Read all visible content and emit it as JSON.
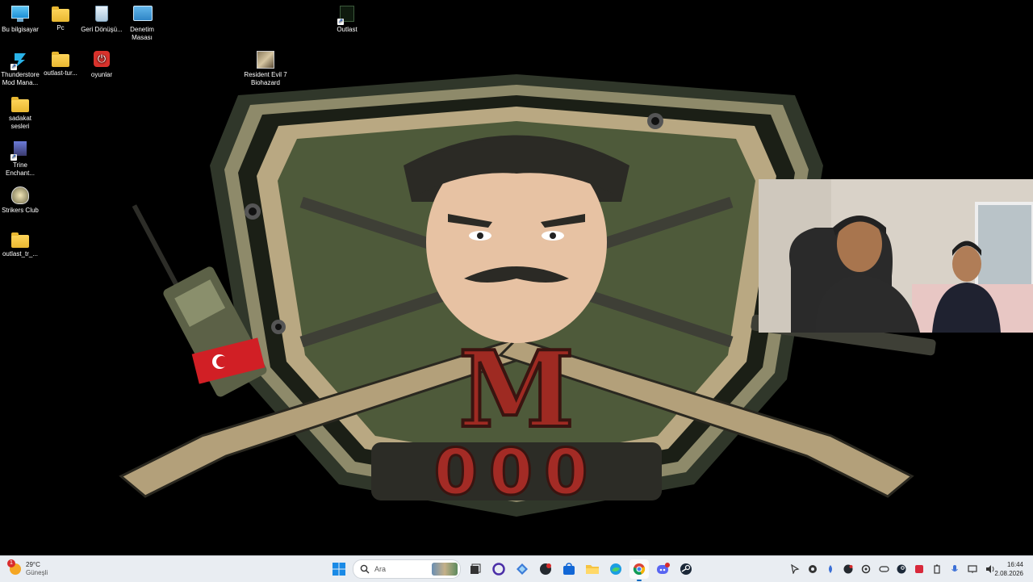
{
  "desktop": {
    "icons": [
      {
        "label": "Bu bilgisayar"
      },
      {
        "label": "Pc"
      },
      {
        "label": "Geri Dönüşü..."
      },
      {
        "label": "Denetim Masası"
      },
      {
        "label": "Outlast"
      },
      {
        "label": "Thunderstore Mod Mana..."
      },
      {
        "label": "outlast-tur..."
      },
      {
        "label": "oyunlar"
      },
      {
        "label": "Resident Evil 7 Biohazard"
      },
      {
        "label": "sadakat sesleri"
      },
      {
        "label": "Trine Enchant..."
      },
      {
        "label": "Strikers Club"
      },
      {
        "label": "outlast_tr_..."
      }
    ]
  },
  "wallpaper": {
    "letter": "M",
    "digits": "000"
  },
  "taskbar": {
    "weather": {
      "badge": "1",
      "temp": "29°C",
      "condition": "Güneşli"
    },
    "search_placeholder": "Ara",
    "clock": {
      "time": "16:44",
      "date": "2.08.2026"
    }
  },
  "colors": {
    "shield_green": "#4e5a3a",
    "shield_dark": "#2c3322",
    "letter_red": "#9e2a22",
    "taskbar_bg": "#e9edf2",
    "accent": "#0067c0"
  }
}
